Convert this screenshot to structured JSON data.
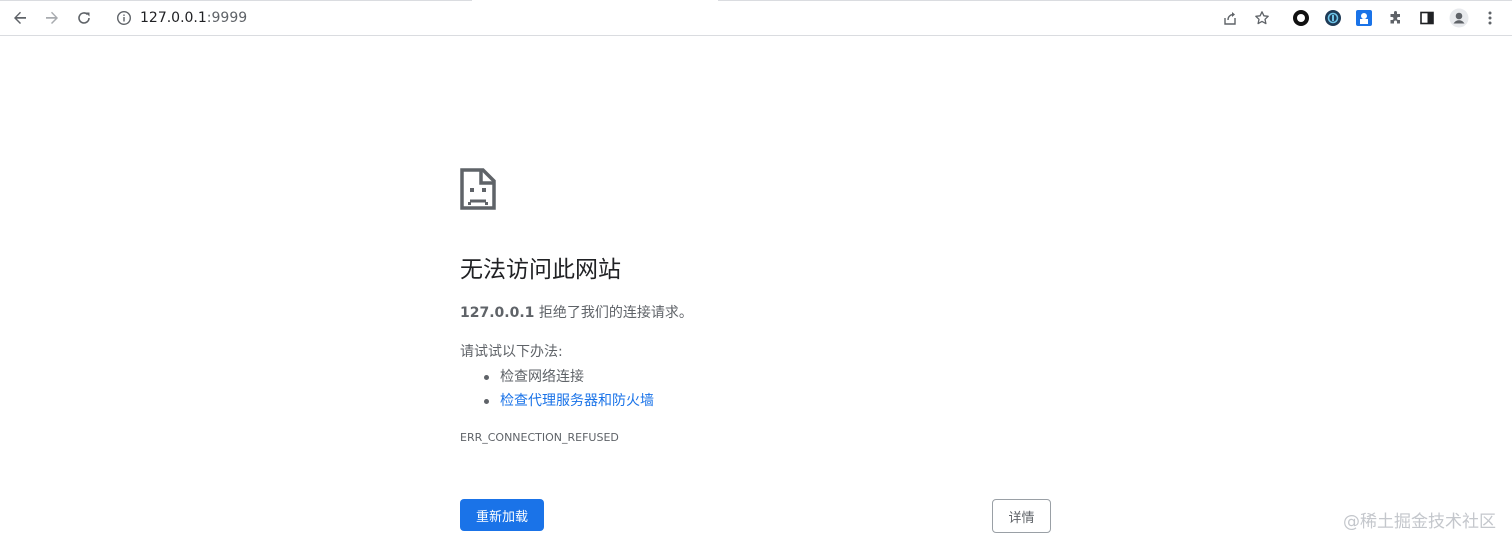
{
  "toolbar": {
    "back_icon": "back-arrow-icon",
    "forward_icon": "forward-arrow-icon",
    "reload_icon": "reload-icon",
    "url_host": "127.0.0.1",
    "url_port": ":9999",
    "right_icons": [
      "share-icon",
      "bookmark-star-icon",
      "extension-circle-icon",
      "extension-translate-icon",
      "extension-blue-icon",
      "puzzle-icon",
      "side-panel-icon",
      "profile-avatar-icon",
      "kebab-menu-icon"
    ]
  },
  "error_page": {
    "title": "无法访问此网站",
    "host": "127.0.0.1",
    "description": " 拒绝了我们的连接请求。",
    "suggestions_title": "请试试以下办法:",
    "suggestions": [
      {
        "text": "检查网络连接",
        "link": false
      },
      {
        "text": "检查代理服务器和防火墙",
        "link": true
      }
    ],
    "error_code": "ERR_CONNECTION_REFUSED",
    "reload_label": "重新加载",
    "details_label": "详情"
  },
  "watermark": "@稀土掘金技术社区",
  "colors": {
    "accent": "#1a73e8",
    "text_primary": "#202124",
    "text_secondary": "#5f6368"
  }
}
